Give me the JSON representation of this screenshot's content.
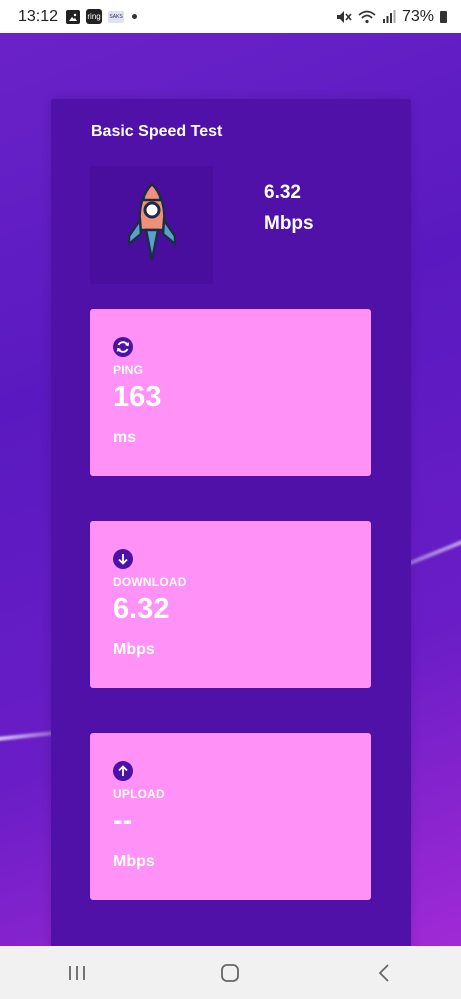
{
  "statusbar": {
    "time": "13:12",
    "notif_ring": "ring",
    "notif_saks": "SAKS",
    "battery": "73%"
  },
  "app": {
    "title": "Basic Speed Test",
    "speed_value": "6.32",
    "speed_unit": "Mbps",
    "colors": {
      "card_bg": "#4f11a8",
      "metric_bg": "#ff91f7",
      "icon_bg": "#4a12a6"
    },
    "metrics": [
      {
        "icon": "ping-refresh-icon",
        "label": "PING",
        "value": "163",
        "unit": "ms"
      },
      {
        "icon": "download-arrow-icon",
        "label": "DOWNLOAD",
        "value": "6.32",
        "unit": "Mbps"
      },
      {
        "icon": "upload-arrow-icon",
        "label": "UPLOAD",
        "value": "--",
        "unit": "Mbps"
      }
    ]
  },
  "navbar": {
    "icons": [
      "recent-apps-icon",
      "home-icon",
      "back-icon"
    ]
  }
}
